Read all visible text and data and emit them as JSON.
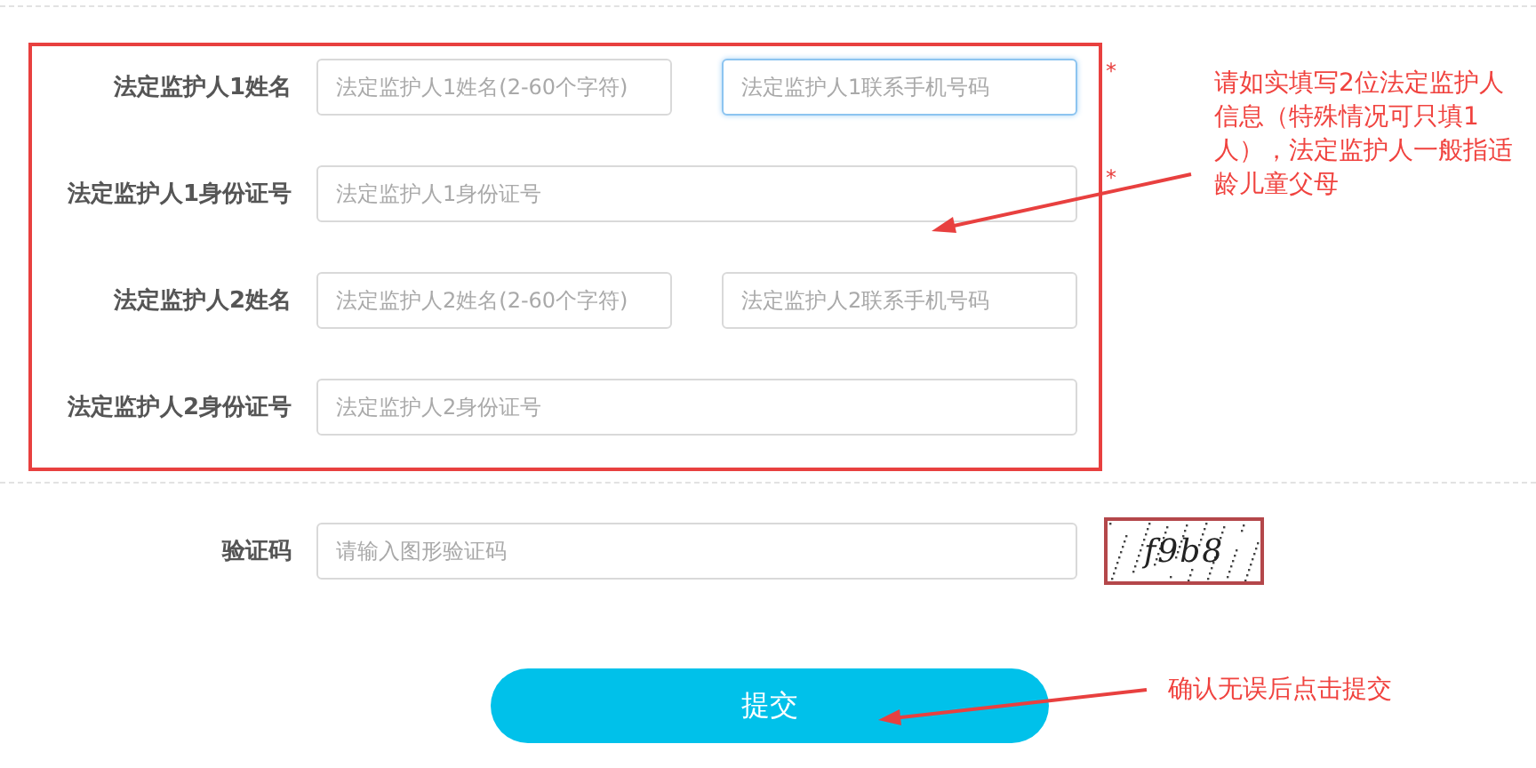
{
  "guardians": [
    {
      "kind": "pair",
      "label": "法定监护人1姓名",
      "required_mark": "*",
      "fields": [
        {
          "placeholder": "法定监护人1姓名(2-60个字符)",
          "focused": false
        },
        {
          "placeholder": "法定监护人1联系手机号码",
          "focused": true
        }
      ]
    },
    {
      "kind": "single",
      "label": "法定监护人1身份证号",
      "required_mark": "*",
      "fields": [
        {
          "placeholder": "法定监护人1身份证号",
          "focused": false
        }
      ]
    },
    {
      "kind": "pair",
      "label": "法定监护人2姓名",
      "fields": [
        {
          "placeholder": "法定监护人2姓名(2-60个字符)",
          "focused": false
        },
        {
          "placeholder": "法定监护人2联系手机号码",
          "focused": false
        }
      ]
    },
    {
      "kind": "single",
      "label": "法定监护人2身份证号",
      "fields": [
        {
          "placeholder": "法定监护人2身份证号",
          "focused": false
        }
      ]
    }
  ],
  "guardian_note": "请如实填写2位法定监护人信息（特殊情况可只填1人），法定监护人一般指适龄儿童父母",
  "captcha": {
    "label": "验证码",
    "placeholder": "请输入图形验证码",
    "code": "f9b8"
  },
  "submit": {
    "label": "提交",
    "note": "确认无误后点击提交"
  }
}
